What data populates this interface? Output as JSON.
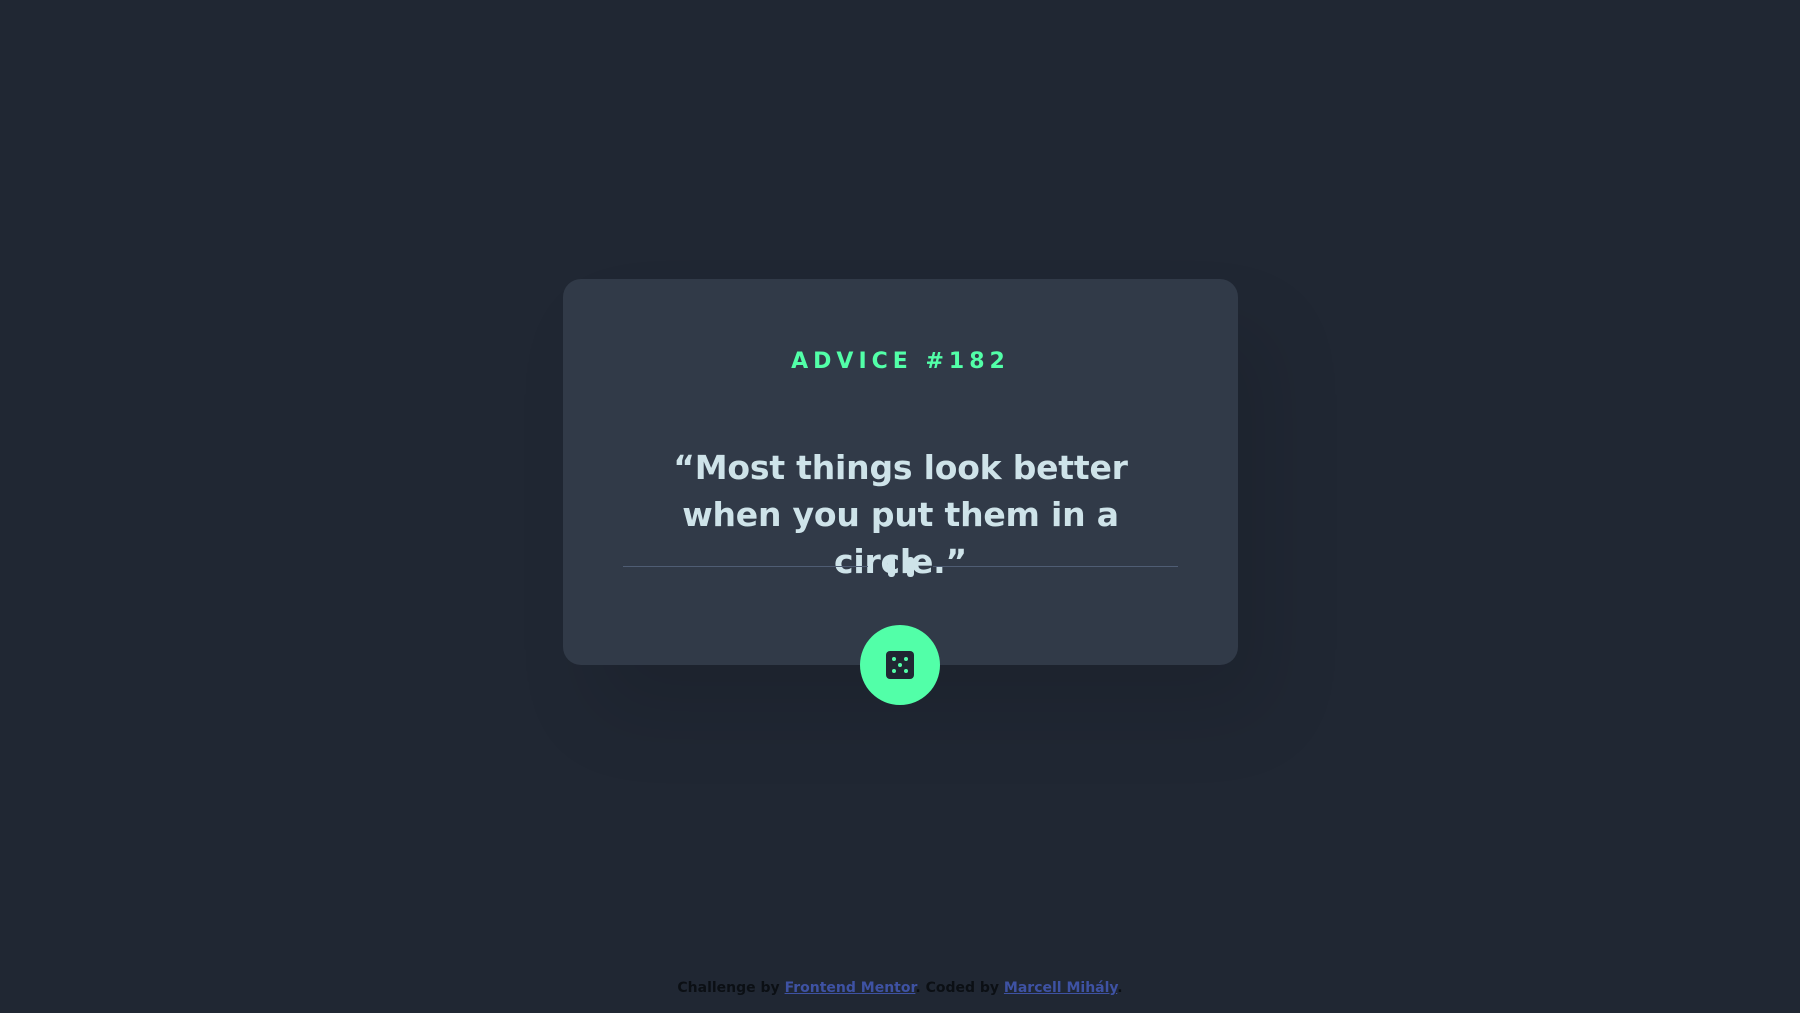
{
  "card": {
    "advice_label": "ADVICE #182",
    "quote": "“Most things look better when you put them in a circle.”"
  },
  "button": {
    "icon": "dice-icon",
    "aria_label": "Generate new advice"
  },
  "footer": {
    "challenge_prefix": "Challenge by ",
    "challenge_link": "Frontend Mentor",
    "coded_prefix": ". Coded by ",
    "coded_link": "Marcell Mihály",
    "suffix": "."
  },
  "colors": {
    "background": "#202733",
    "card": "#313a48",
    "accent": "#52ffa8",
    "quote_text": "#cee3e9",
    "divider": "#4f5d74",
    "link": "#3e52a3"
  }
}
